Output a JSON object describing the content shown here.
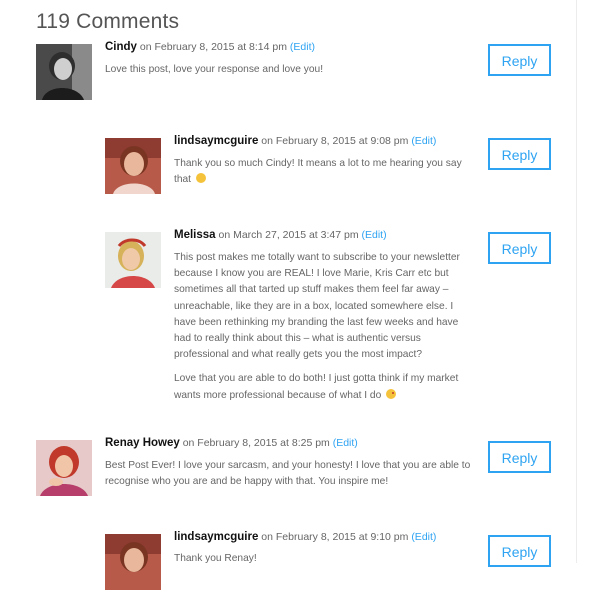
{
  "comments_title": "119 Comments",
  "comments": [
    {
      "author": "Cindy",
      "date": "on February 8, 2015 at 8:14 pm",
      "edit": "(Edit)",
      "paragraphs": [
        "Love this post, love your response and love you!"
      ],
      "reply": "Reply"
    },
    {
      "author": "lindsaymcguire",
      "date": "on February 8, 2015 at 9:08 pm",
      "edit": "(Edit)",
      "line1": "Thank you so much Cindy! It means a lot to me hearing you say",
      "line2": "that",
      "emoji": "smile-emoji",
      "reply": "Reply"
    },
    {
      "author": "Melissa",
      "date": "on March 27, 2015 at 3:47 pm",
      "edit": "(Edit)",
      "para1": "This post makes me totally want to subscribe to your newsletter because I know you are REAL! I love Marie, Kris Carr etc but sometimes all that tarted up stuff makes them feel far away – unreachable, like they are in a box, located somewhere else. I have been rethinking my branding the last few weeks and have had to really think about this – what is authentic versus professional and what really gets you the most impact?",
      "para2": "Love that you are able to do both! I just gotta think if my market wants more professional because of what I do",
      "emoji": "wink-emoji",
      "reply": "Reply"
    },
    {
      "author": "Renay Howey",
      "date": "on February 8, 2015 at 8:25 pm",
      "edit": "(Edit)",
      "paragraphs": [
        "Best Post Ever! I love your sarcasm, and your honesty! I love that you are able to recognise who you are and be happy with that. You inspire me!"
      ],
      "reply": "Reply"
    },
    {
      "author": "lindsaymcguire",
      "date": "on February 8, 2015 at 9:10 pm",
      "edit": "(Edit)",
      "paragraphs": [
        "Thank you Renay!"
      ],
      "reply": "Reply"
    }
  ],
  "colors": {
    "link": "#2ea3f2",
    "author": "#111111",
    "text": "#666666"
  }
}
